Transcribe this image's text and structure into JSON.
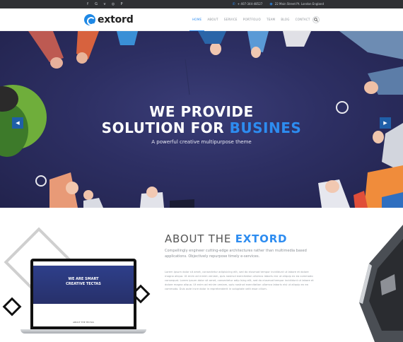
{
  "topbar": {
    "social": [
      {
        "name": "facebook-icon",
        "glyph": "f"
      },
      {
        "name": "google-plus-icon",
        "glyph": "G"
      },
      {
        "name": "twitter-icon",
        "glyph": "v"
      },
      {
        "name": "instagram-icon",
        "glyph": "◎"
      },
      {
        "name": "pinterest-icon",
        "glyph": "P"
      }
    ],
    "phone": "+ 407-344-48527",
    "address": "22 Main Street Pt. London England"
  },
  "header": {
    "logo_text": "extord",
    "nav": [
      "HOME",
      "ABOUT",
      "SERVICE",
      "PORTFOLIO",
      "TEAM",
      "BLOG",
      "CONTACT"
    ],
    "active_nav": "HOME"
  },
  "hero": {
    "line1": "WE PROVIDE",
    "line2_prefix": "SOLUTION FOR ",
    "line2_accent": "BUSINES",
    "subtitle": "A powerful creative multipurpose theme",
    "prev_icon": "chevron-left-icon",
    "next_icon": "chevron-right-icon"
  },
  "about": {
    "title_prefix": "ABOUT THE ",
    "title_accent": "EXTORD",
    "lead": "Compellingly engineer cutting-edge architectures rather than multimedia based applications. Objectively repurpose timely e-services.",
    "body": "Lorem ipsum dolor sit amet, consectetur adipisicing elit, sed do eiusmod tempor incididunt ut labore et dolore magna aliqua. Ut enim ad minim veniam, quis nostrud exercitation ullamco laboris nisi ut aliquip ex ea commodo consequat. Lorem ipsum dolor sit amet, consectetur adip Ising elit, sed do eiusmod tempor incididunt ut labore et dolore magna aliqua. Ut enim ad minim veniam, quis nostrud exercitation ullamco laboris nisi ut aliquip ex ea commodo. Duis aute irure dolor in reprehenderit in voluptate velit esse cillum.",
    "mockup": {
      "hero_line1": "WE ARE SMART",
      "hero_line2": "CREATIVE TECTAS",
      "about_label": "ABOUT THE TECTAS"
    }
  },
  "colors": {
    "accent": "#2d8cf0",
    "topbar": "#2f3033",
    "hero_bg": "#2d2f63"
  }
}
